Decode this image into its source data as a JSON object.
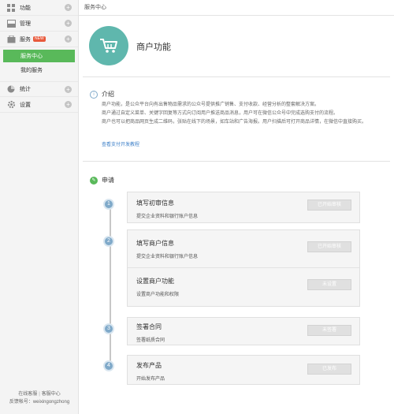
{
  "sidebar": {
    "items": [
      {
        "label": "功能",
        "icon": "grid-icon"
      },
      {
        "label": "管理",
        "icon": "inbox-icon"
      },
      {
        "label": "服务",
        "icon": "service-icon",
        "badge": "NEW"
      },
      {
        "label": "统计",
        "icon": "pie-chart-icon"
      },
      {
        "label": "设置",
        "icon": "gear-icon"
      }
    ],
    "sub_items": [
      "服务中心",
      "我的服务"
    ],
    "footer": {
      "link1": "在线客服",
      "separator": "|",
      "link2": "客服中心",
      "feedback_label": "反馈帐号：weixingongzhong"
    }
  },
  "breadcrumb": "服务中心",
  "hero": {
    "title": "商户功能"
  },
  "intro": {
    "title": "介绍",
    "paragraphs": [
      "商户功能，是公众平台向有出售物品需求的公众号提供推广销售、支付收款、经营分析的整套解决方案。",
      "商户通过自定义菜单、关键字回复等方式向订阅用户推送商品消息，用户可在微信公众号中完成选购支付的流程。",
      "商户也可以把商品网页生成二维码，张贴在线下的场景，如车站和广告海报。用户扫描后可打开商品详情，在微信中直接购买。"
    ],
    "link": "查看支付开发教程"
  },
  "apply": {
    "title": "申请"
  },
  "steps": [
    {
      "number": "1",
      "title": "填写初审信息",
      "desc": "提交企业资料和银行账户信息",
      "button": "已开始审核"
    },
    {
      "number": "2",
      "title": "填写商户信息",
      "desc": "提交企业资料和银行账户信息",
      "button": "已开始审核",
      "sub": {
        "title": "设置商户功能",
        "desc": "设置商户功能和权限",
        "button": "未设置"
      }
    },
    {
      "number": "3",
      "title": "签署合同",
      "desc": "签署纸质合同",
      "button": "未签署"
    },
    {
      "number": "4",
      "title": "发布产品",
      "desc": "开始发布产品",
      "button": "已发布"
    }
  ],
  "colors": {
    "accent_green": "#59b95a",
    "hero_teal": "#5fb7ad",
    "step_blue": "#7fa9c9",
    "link_blue": "#3c7fc8"
  }
}
